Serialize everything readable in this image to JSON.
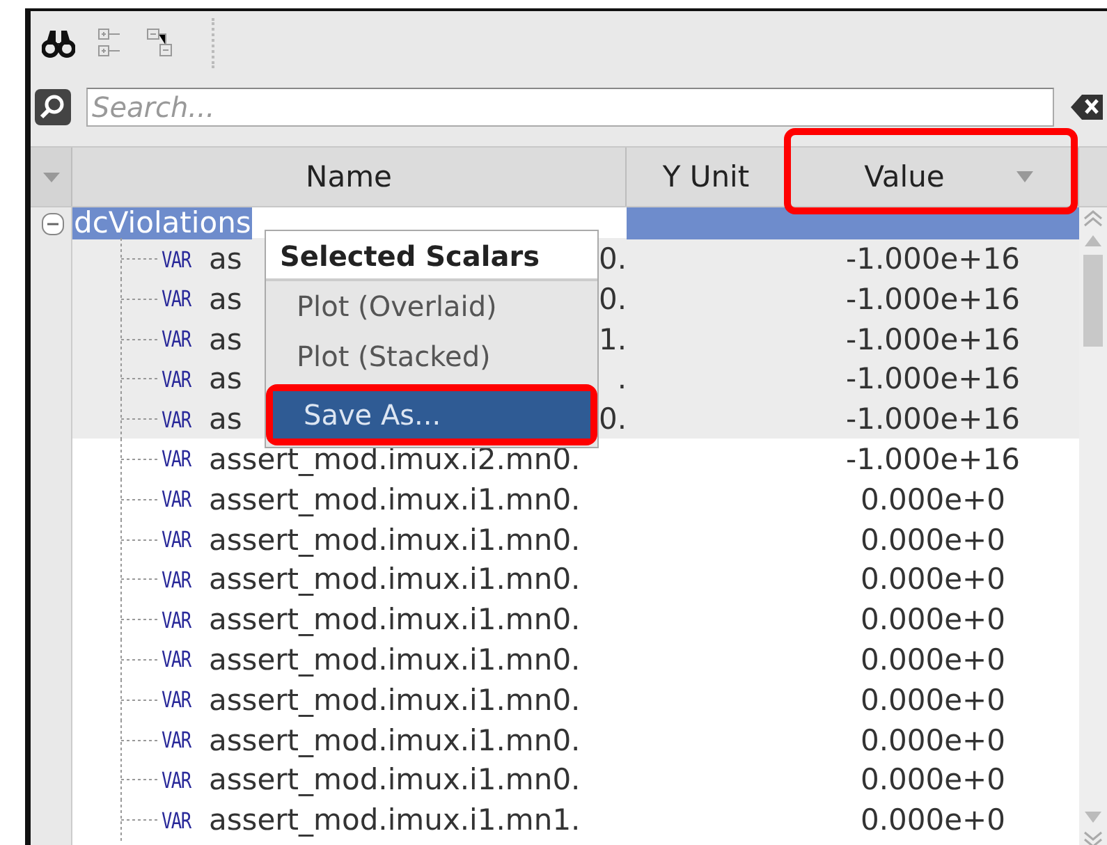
{
  "toolbar": {
    "items": [
      {
        "kind": "find"
      },
      {
        "kind": "expand"
      },
      {
        "kind": "collapse"
      }
    ]
  },
  "search": {
    "placeholder": "Search..."
  },
  "table": {
    "columns": [
      {
        "kind": "sort"
      },
      {
        "kind": "text",
        "label": "Name"
      },
      {
        "kind": "text",
        "label": "Y Unit"
      },
      {
        "kind": "sorted",
        "label": "Value",
        "annotated": true
      }
    ],
    "root": {
      "name": "dcViolations",
      "expanded": true,
      "selected": true,
      "children": [
        {
          "type": "VAR",
          "name_parts": [
            "as",
            "0."
          ],
          "value": "-1.000e+16",
          "selected": true
        },
        {
          "type": "VAR",
          "name_parts": [
            "as",
            "0."
          ],
          "value": "-1.000e+16",
          "selected": true
        },
        {
          "type": "VAR",
          "name_parts": [
            "as",
            "1."
          ],
          "value": "-1.000e+16",
          "selected": true
        },
        {
          "type": "VAR",
          "name_parts": [
            "as",
            "."
          ],
          "value": "-1.000e+16",
          "selected": true
        },
        {
          "type": "VAR",
          "name_parts": [
            "as",
            "0."
          ],
          "value": "-1.000e+16",
          "selected": true
        },
        {
          "type": "VAR",
          "name": "assert_mod.imux.i2.mn0.",
          "value": "-1.000e+16",
          "selected": false
        },
        {
          "type": "VAR",
          "name": "assert_mod.imux.i1.mn0.",
          "value": "0.000e+0",
          "selected": false
        },
        {
          "type": "VAR",
          "name": "assert_mod.imux.i1.mn0.",
          "value": "0.000e+0",
          "selected": false
        },
        {
          "type": "VAR",
          "name": "assert_mod.imux.i1.mn0.",
          "value": "0.000e+0",
          "selected": false
        },
        {
          "type": "VAR",
          "name": "assert_mod.imux.i1.mn0.",
          "value": "0.000e+0",
          "selected": false
        },
        {
          "type": "VAR",
          "name": "assert_mod.imux.i1.mn0.",
          "value": "0.000e+0",
          "selected": false
        },
        {
          "type": "VAR",
          "name": "assert_mod.imux.i1.mn0.",
          "value": "0.000e+0",
          "selected": false
        },
        {
          "type": "VAR",
          "name": "assert_mod.imux.i1.mn0.",
          "value": "0.000e+0",
          "selected": false
        },
        {
          "type": "VAR",
          "name": "assert_mod.imux.i1.mn0.",
          "value": "0.000e+0",
          "selected": false
        },
        {
          "type": "VAR",
          "name": "assert_mod.imux.i1.mn1.",
          "value": "0.000e+0",
          "selected": false
        }
      ]
    }
  },
  "context_menu": {
    "title": "Selected Scalars",
    "items": [
      {
        "label": "Plot (Overlaid)",
        "selected": false,
        "annotated": false
      },
      {
        "label": "Plot (Stacked)",
        "selected": false,
        "annotated": false
      },
      {
        "label": "Save As...",
        "selected": true,
        "annotated": true
      }
    ]
  }
}
